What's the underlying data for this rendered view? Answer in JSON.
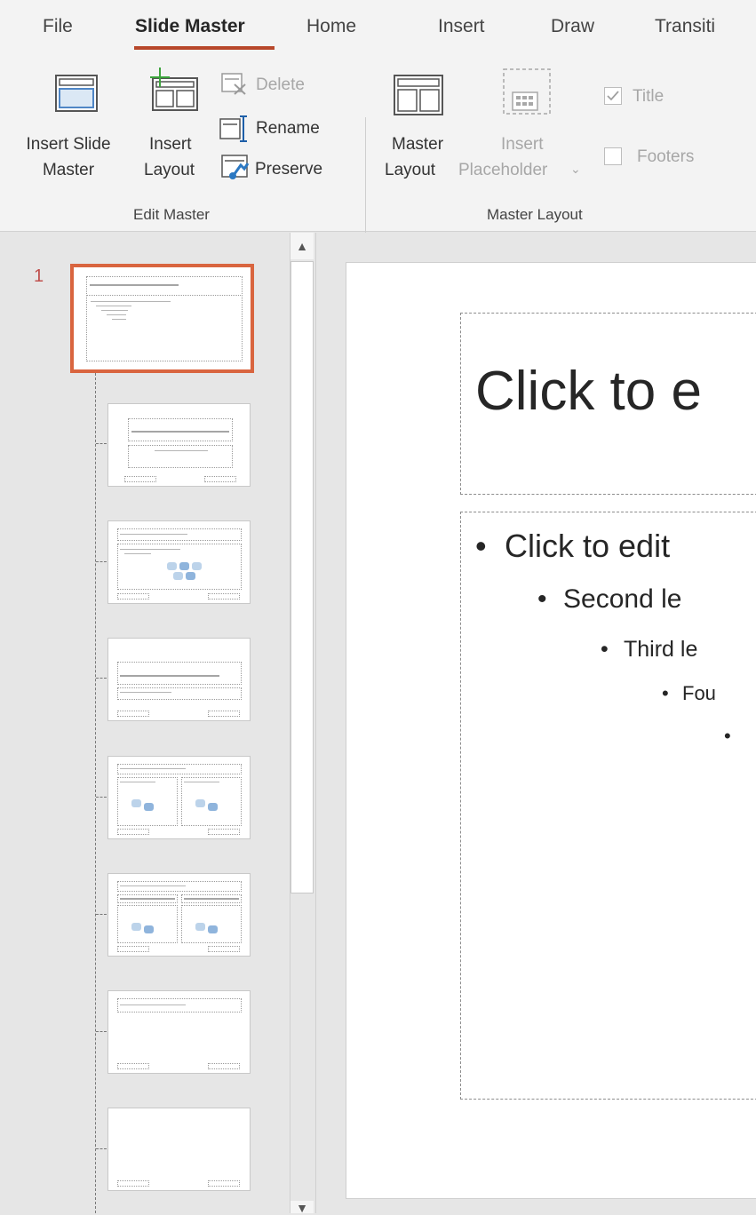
{
  "tabs": [
    {
      "label": "File",
      "active": false
    },
    {
      "label": "Slide Master",
      "active": true
    },
    {
      "label": "Home",
      "active": false
    },
    {
      "label": "Insert",
      "active": false
    },
    {
      "label": "Draw",
      "active": false
    },
    {
      "label": "Transiti",
      "active": false
    }
  ],
  "ribbon": {
    "edit_master": {
      "insert_slide_master": {
        "line1": "Insert Slide",
        "line2": "Master"
      },
      "insert_layout": {
        "line1": "Insert",
        "line2": "Layout"
      },
      "delete": "Delete",
      "rename": "Rename",
      "preserve": "Preserve",
      "group_label": "Edit Master"
    },
    "master_layout": {
      "master_layout_btn": {
        "line1": "Master",
        "line2": "Layout"
      },
      "insert_placeholder": {
        "line1": "Insert",
        "line2": "Placeholder",
        "arrow": "⌄"
      },
      "title_checkbox": {
        "label": "Title",
        "checked": true
      },
      "footers_checkbox": {
        "label": "Footers",
        "checked": false
      },
      "group_label": "Master Layout"
    }
  },
  "thumbnails": {
    "slide_number": "1",
    "master_title_text": "Click to edit Master title style"
  },
  "slide": {
    "title": "Click to e",
    "bullets": [
      {
        "level": 1,
        "text": "Click to edit"
      },
      {
        "level": 2,
        "text": "Second le"
      },
      {
        "level": 3,
        "text": "Third le"
      },
      {
        "level": 4,
        "text": "Fou"
      },
      {
        "level": 5,
        "text": ""
      }
    ]
  },
  "colors": {
    "accent": "#b7472a",
    "selection": "#d9653f",
    "background": "#e6e6e6",
    "ribbon": "#f3f3f3"
  },
  "icons": [
    "insert-slide-master-icon",
    "insert-layout-icon",
    "delete-icon",
    "rename-icon",
    "preserve-icon",
    "master-layout-icon",
    "insert-placeholder-icon",
    "checkbox-icon",
    "scroll-up-icon",
    "scroll-down-icon"
  ]
}
